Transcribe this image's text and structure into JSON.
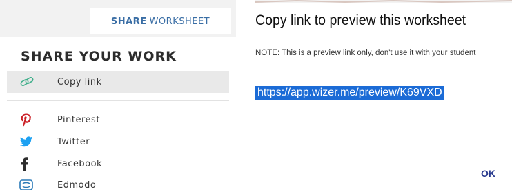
{
  "left": {
    "share_button": {
      "part1": "SHARE",
      "part2": "WORKSHEET"
    },
    "title": "SHARE YOUR WORK",
    "items": [
      {
        "label": "Copy link",
        "icon": "link-icon",
        "active": true
      },
      {
        "label": "Pinterest",
        "icon": "pinterest-icon"
      },
      {
        "label": "Twitter",
        "icon": "twitter-icon"
      },
      {
        "label": "Facebook",
        "icon": "facebook-icon"
      },
      {
        "label": "Edmodo",
        "icon": "edmodo-icon"
      }
    ]
  },
  "dialog": {
    "title": "Copy link to preview this worksheet",
    "note": "NOTE: This is a preview link only, don't use it with your student",
    "link": "https://app.wizer.me/preview/K69VXD",
    "ok_label": "OK"
  },
  "colors": {
    "accent_link": "#3a6ea5",
    "selection_blue": "#1b6bd6",
    "ok_button": "#2a3b8f",
    "pinterest": "#cb2027",
    "twitter": "#1da1f2",
    "facebook": "#2d2d2d",
    "edmodo": "#2a7ab8",
    "copy_link_icon": "#3fae8a"
  }
}
